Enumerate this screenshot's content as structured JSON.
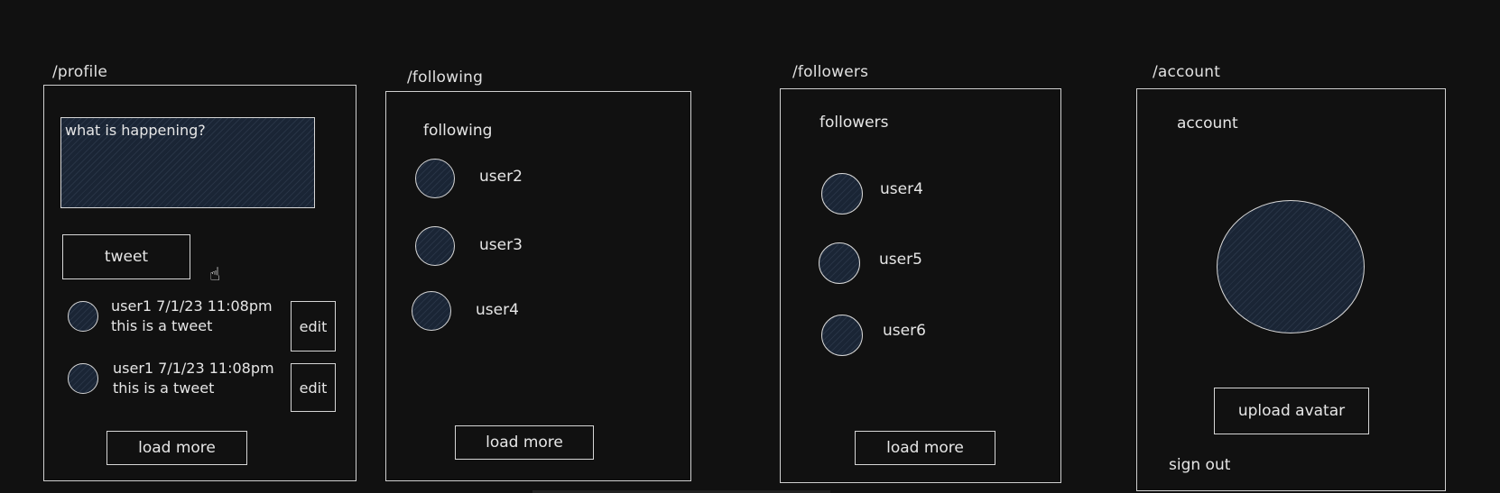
{
  "profile": {
    "route": "/profile",
    "textarea_placeholder": "what is happening?",
    "tweet_button": "tweet",
    "tweets": [
      {
        "meta": "user1 7/1/23 11:08pm",
        "text": "this is a tweet",
        "edit": "edit"
      },
      {
        "meta": "user1 7/1/23 11:08pm",
        "text": "this is a tweet",
        "edit": "edit"
      }
    ],
    "load_more": "load more"
  },
  "following": {
    "route": "/following",
    "heading": "following",
    "users": [
      "user2",
      "user3",
      "user4"
    ],
    "load_more": "load more"
  },
  "followers": {
    "route": "/followers",
    "heading": "followers",
    "users": [
      "user4",
      "user5",
      "user6"
    ],
    "load_more": "load more"
  },
  "account": {
    "route": "/account",
    "heading": "account",
    "upload_button": "upload avatar",
    "sign_out": "sign out"
  },
  "colors": {
    "background": "#111111",
    "stroke": "#d6d6d6",
    "fill": "#1a2535"
  },
  "icons": {
    "cursor": "hand-pointer-icon"
  }
}
